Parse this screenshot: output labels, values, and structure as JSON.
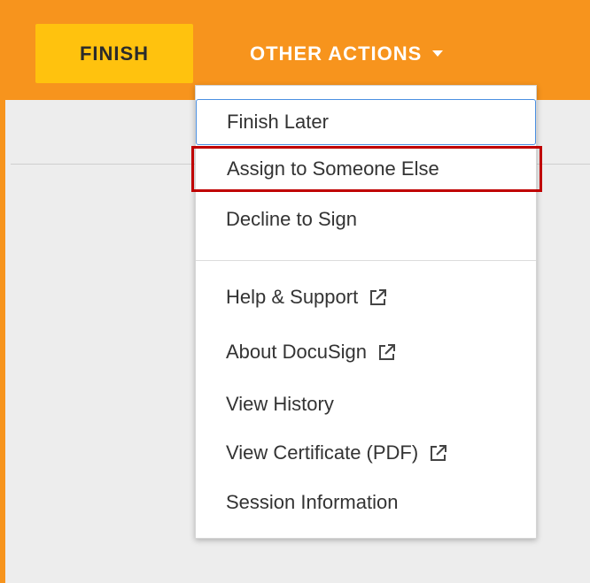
{
  "toolbar": {
    "finish_label": "FINISH",
    "other_actions_label": "OTHER ACTIONS",
    "accent_color": "#f7941d",
    "finish_color": "#ffc20e"
  },
  "menu": {
    "items": [
      {
        "label": "Finish Later",
        "icon": ""
      },
      {
        "label": "Assign to Someone Else",
        "icon": ""
      },
      {
        "label": "Decline to Sign",
        "icon": ""
      },
      {
        "label": "Help & Support",
        "icon": "external-link-icon"
      },
      {
        "label": "About DocuSign",
        "icon": "external-link-icon"
      },
      {
        "label": "View History",
        "icon": ""
      },
      {
        "label": "View Certificate (PDF)",
        "icon": "external-link-icon"
      },
      {
        "label": "Session Information",
        "icon": ""
      }
    ],
    "highlight_color": "#c00000"
  }
}
